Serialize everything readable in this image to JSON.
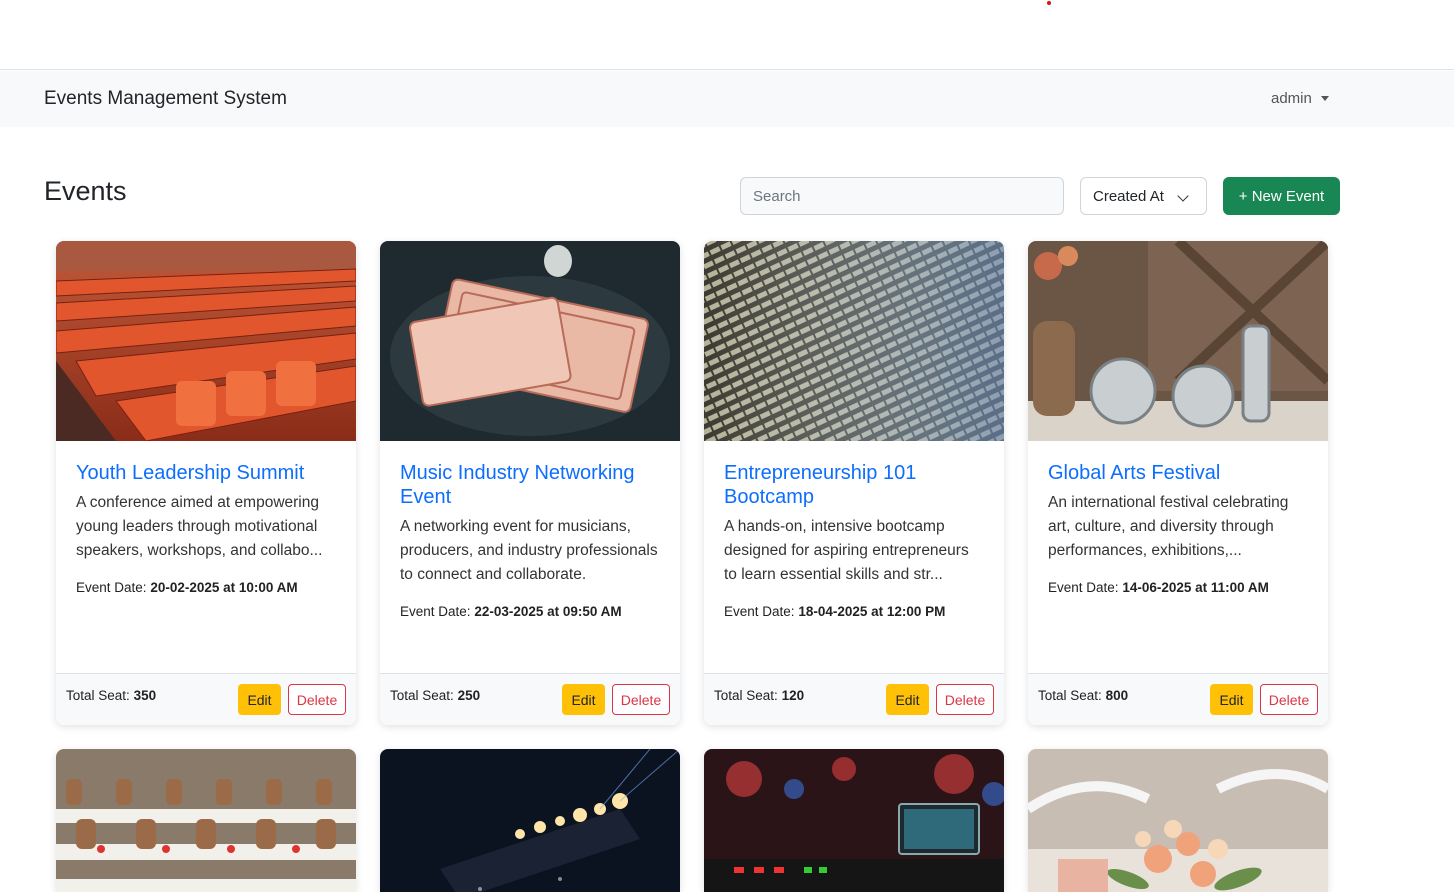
{
  "app": {
    "brand": "Events Management System",
    "user": "admin"
  },
  "page": {
    "title": "Events"
  },
  "toolbar": {
    "search_placeholder": "Search",
    "sort_value": "Created At",
    "new_button": "+ New Event"
  },
  "labels": {
    "event_date": "Event Date:",
    "total_seat": "Total Seat:",
    "edit": "Edit",
    "delete": "Delete"
  },
  "events": [
    {
      "title": "Youth Leadership Summit",
      "description": "A conference aimed at empowering young leaders through motivational speakers, workshops, and collabo...",
      "date": "20-02-2025 at 10:00 AM",
      "seats": "350",
      "image": "stadium-seats-photo"
    },
    {
      "title": "Music Industry Networking Event",
      "description": "A networking event for musicians, producers, and industry professionals to connect and collaborate.",
      "date": "22-03-2025 at 09:50 AM",
      "seats": "250",
      "image": "tickets-photo"
    },
    {
      "title": "Entrepreneurship 101 Bootcamp",
      "description": "A hands-on, intensive bootcamp designed for aspiring entrepreneurs to learn essential skills and str...",
      "date": "18-04-2025 at 12:00 PM",
      "seats": "120",
      "image": "arena-seats-photo"
    },
    {
      "title": "Global Arts Festival",
      "description": "An international festival celebrating art, culture, and diversity through performances, exhibitions,...",
      "date": "14-06-2025 at 11:00 AM",
      "seats": "800",
      "image": "eat-sign-photo"
    }
  ],
  "more_events": [
    {
      "image": "banquet-hall-photo"
    },
    {
      "image": "concert-stage-photo"
    },
    {
      "image": "dj-laptop-photo"
    },
    {
      "image": "flower-centerpiece-photo"
    }
  ],
  "colors": {
    "primary": "#0d6efd",
    "success": "#198754",
    "warning": "#ffc107",
    "danger": "#dc3545"
  }
}
